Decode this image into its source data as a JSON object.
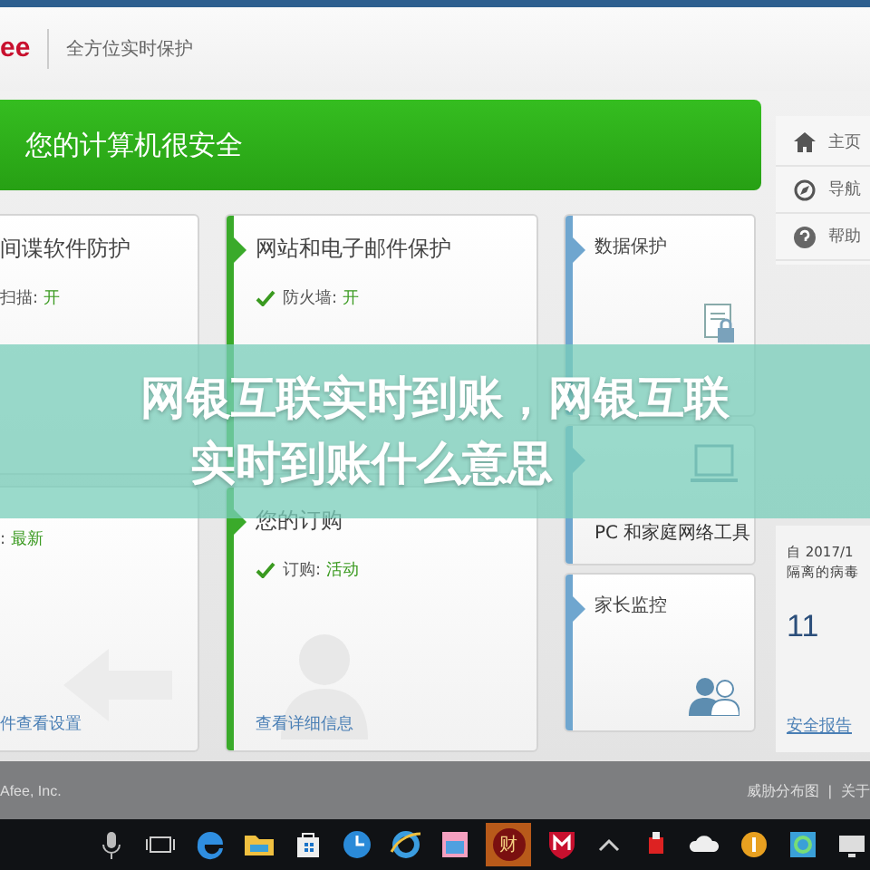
{
  "header": {
    "logo": "ee",
    "tagline": "全方位实时保护"
  },
  "status_bar": {
    "text": "您的计算机很安全"
  },
  "nav": [
    {
      "label": "主页"
    },
    {
      "label": "导航"
    },
    {
      "label": "帮助"
    }
  ],
  "columns": [
    [
      {
        "title": "间谍软件防护",
        "status": {
          "label": "扫描:",
          "value": "开",
          "checked": false
        }
      },
      {
        "status": {
          "label": ":",
          "value": "最新",
          "checked": false
        },
        "link": "件查看设置"
      }
    ],
    [
      {
        "title": "网站和电子邮件保护",
        "color": "#3aaa2a",
        "status": {
          "label": "防火墙:",
          "value": "开",
          "checked": true
        }
      },
      {
        "title": "您的订购",
        "color": "#3aaa2a",
        "status": {
          "label": "订购:",
          "value": "活动",
          "checked": true
        },
        "link": "查看详细信息"
      }
    ],
    [
      {
        "title": "数据保护",
        "color": "#6fa6cf"
      },
      {
        "title": "PC 和家庭网络工具",
        "color": "#6fa6cf"
      },
      {
        "title": "家长监控",
        "color": "#6fa6cf"
      }
    ]
  ],
  "stats": {
    "since": "自 2017/1",
    "caption": "隔离的病毒",
    "count": "11",
    "link": "安全报告"
  },
  "footer": {
    "copyright": "Afee, Inc.",
    "links": [
      "威胁分布图",
      "关于"
    ],
    "separator": "|"
  },
  "taskbar": {
    "apps": [
      {
        "kind": "mic",
        "selected": false
      },
      {
        "kind": "taskview",
        "selected": false
      },
      {
        "kind": "edge",
        "selected": false
      },
      {
        "kind": "folder",
        "selected": false
      },
      {
        "kind": "store",
        "selected": false
      },
      {
        "kind": "clock",
        "selected": false
      },
      {
        "kind": "ie",
        "selected": false
      },
      {
        "kind": "photos",
        "selected": false
      },
      {
        "kind": "text",
        "label": "财",
        "selected": true
      },
      {
        "kind": "shield",
        "selected": false
      },
      {
        "kind": "chevron",
        "selected": false
      },
      {
        "kind": "tray",
        "selected": false
      },
      {
        "kind": "cloud",
        "selected": false
      },
      {
        "kind": "coin",
        "selected": false
      },
      {
        "kind": "app",
        "selected": false
      },
      {
        "kind": "screen",
        "selected": false
      }
    ]
  },
  "overlay": {
    "lines": [
      "网银互联实时到账，网银互联",
      "实时到账什么意思"
    ]
  }
}
